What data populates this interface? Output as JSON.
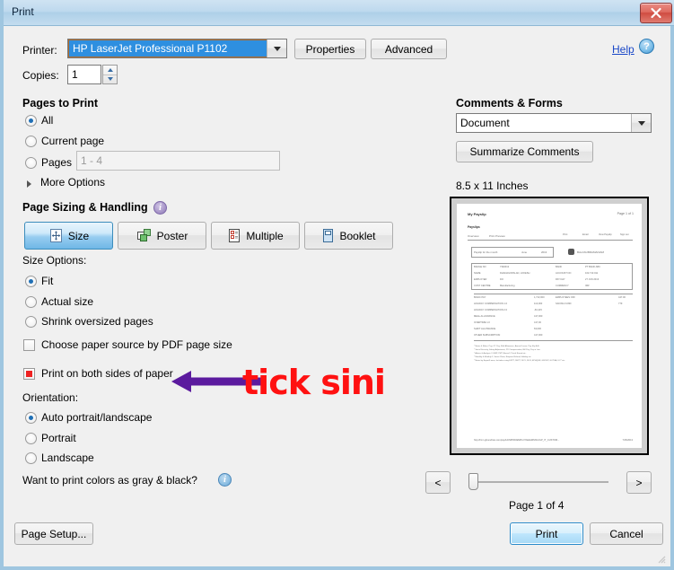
{
  "window": {
    "title": "Print",
    "close_label": "x"
  },
  "printer": {
    "label": "Printer:",
    "value": "HP LaserJet Professional P1102",
    "properties_label": "Properties",
    "advanced_label": "Advanced"
  },
  "copies": {
    "label": "Copies:",
    "value": "1"
  },
  "help": {
    "label": "Help",
    "icon_glyph": "?"
  },
  "pages_to_print": {
    "heading": "Pages to Print",
    "options": [
      {
        "label": "All",
        "selected": true
      },
      {
        "label": "Current page",
        "selected": false
      },
      {
        "label": "Pages",
        "selected": false
      }
    ],
    "pages_value": "1 - 4",
    "more_options_label": "More Options"
  },
  "page_sizing": {
    "heading": "Page Sizing & Handling",
    "info_glyph": "i",
    "modes": [
      {
        "label": "Size",
        "icon": "size-icon",
        "active": true
      },
      {
        "label": "Poster",
        "icon": "poster-icon",
        "active": false
      },
      {
        "label": "Multiple",
        "icon": "multiple-icon",
        "active": false
      },
      {
        "label": "Booklet",
        "icon": "booklet-icon",
        "active": false
      }
    ],
    "size_options_label": "Size Options:",
    "size_options": [
      {
        "label": "Fit",
        "selected": true
      },
      {
        "label": "Actual size",
        "selected": false
      },
      {
        "label": "Shrink oversized pages",
        "selected": false
      }
    ],
    "checkboxes": [
      {
        "label": "Choose paper source by PDF page size",
        "checked": false
      },
      {
        "label": "Print on both sides of paper",
        "checked": false
      }
    ]
  },
  "orientation": {
    "label": "Orientation:",
    "options": [
      {
        "label": "Auto portrait/landscape",
        "selected": true
      },
      {
        "label": "Portrait",
        "selected": false
      },
      {
        "label": "Landscape",
        "selected": false
      }
    ],
    "gray_question": "Want to print colors as gray & black?",
    "info_glyph": "i"
  },
  "comments_forms": {
    "heading": "Comments & Forms",
    "value": "Document",
    "summarize_label": "Summarize Comments"
  },
  "preview": {
    "paper_size": "8.5 x 11 Inches",
    "page_indicator": "Page 1 of 4",
    "prev_label": "<",
    "next_label": ">",
    "document": {
      "title": "My Payslip",
      "page_label": "Page 1 of 1",
      "section": "Payslips",
      "tabs": [
        "Overview",
        "Print Preview"
      ],
      "row_label": "Payslip for the month",
      "row_value_1": "June",
      "row_value_2": "2013",
      "company": "BALASUBRAMANIAM",
      "fields": [
        [
          "BADGE NO",
          "7392013"
        ],
        [
          "NAME",
          "DHANAGOPALAN, LOKESH"
        ],
        [
          "EMPLOYER",
          "DO"
        ],
        [
          "COST CENTRE",
          "Manufacturing"
        ]
      ],
      "fields_right": [
        [
          "BANK",
          "PT BANK ABC"
        ],
        [
          "ACCOUNT NO",
          "102.713.011"
        ],
        [
          "PAY DAY",
          "27 JUN 2013"
        ],
        [
          "CURRENCY",
          "IDR"
        ]
      ],
      "earnings": [
        [
          "BASIC PAY",
          "1,713,000"
        ],
        [
          "HOLIDAY COMPENSATION 1.0",
          "113,000"
        ],
        [
          "HOLIDAY COMPENSATION 2.0",
          "-63,415"
        ],
        [
          "MEAL ALLOWANCE",
          "417,000"
        ],
        [
          "OVERTIME 1.0",
          "417,00"
        ],
        [
          "SHIFT ALLOWANCE",
          "63,000"
        ],
        [
          "OTHER SUBSCRIPTION",
          "417,000"
        ]
      ],
      "deductions": [
        [
          "EMPLOYEES OFF",
          "447.00"
        ],
        [
          "SAVING FUND",
          "779"
        ]
      ],
      "url_footer": "http://hcm.gfoundries.com/psp/HCMPRD/EMPLOYEE/HRMS/c/GP_IT_CUSTOM...",
      "url_date": "7/15/2013"
    }
  },
  "footer": {
    "page_setup_label": "Page Setup...",
    "print_label": "Print",
    "cancel_label": "Cancel"
  },
  "annotations": {
    "note_text": "tick sini",
    "note_color": "#ff1111",
    "arrow_color": "#5b1a9e"
  }
}
